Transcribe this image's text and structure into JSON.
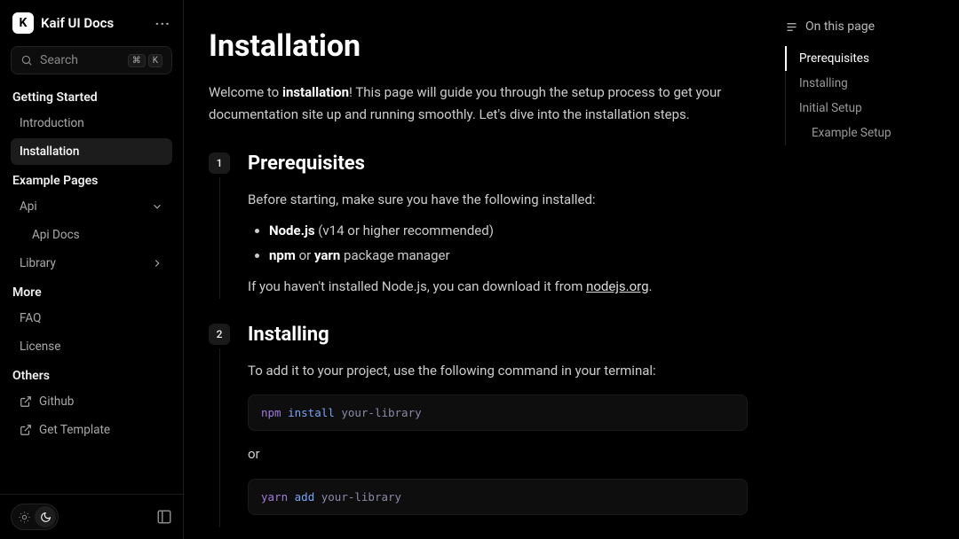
{
  "brand": {
    "logo_letter": "K",
    "title": "Kaif UI Docs"
  },
  "search": {
    "placeholder": "Search",
    "kbd1": "⌘",
    "kbd2": "K"
  },
  "sidebar": {
    "sections": [
      {
        "title": "Getting Started",
        "items": [
          {
            "label": "Introduction",
            "active": false
          },
          {
            "label": "Installation",
            "active": true
          }
        ]
      },
      {
        "title": "Example Pages",
        "items": [
          {
            "label": "Api",
            "chevron": "down",
            "active": false
          },
          {
            "label": "Api Docs",
            "sub": true,
            "active": false
          },
          {
            "label": "Library",
            "chevron": "right",
            "active": false
          }
        ]
      },
      {
        "title": "More",
        "items": [
          {
            "label": "FAQ",
            "active": false
          },
          {
            "label": "License",
            "active": false
          }
        ]
      },
      {
        "title": "Others",
        "items": [
          {
            "label": "Github",
            "icon": "external",
            "active": false
          },
          {
            "label": "Get Template",
            "icon": "external",
            "active": false
          }
        ]
      }
    ]
  },
  "toc": {
    "header": "On this page",
    "items": [
      {
        "label": "Prerequisites",
        "active": true,
        "indent": false
      },
      {
        "label": "Installing",
        "active": false,
        "indent": false
      },
      {
        "label": "Initial Setup",
        "active": false,
        "indent": false
      },
      {
        "label": "Example Setup",
        "active": false,
        "indent": true
      }
    ]
  },
  "content": {
    "title": "Installation",
    "intro_pre": "Welcome to ",
    "intro_bold": "installation",
    "intro_post": "! This page will guide you through the setup process to get your documentation site up and running smoothly. Let's dive into the installation steps.",
    "steps": {
      "prereq": {
        "num": "1",
        "title": "Prerequisites",
        "p1": "Before starting, make sure you have the following installed:",
        "li1_b": "Node.js",
        "li1_t": " (v14 or higher recommended)",
        "li2_b1": "npm",
        "li2_mid": " or ",
        "li2_b2": "yarn",
        "li2_t": " package manager",
        "p2_pre": "If you haven't installed Node.js, you can download it from ",
        "p2_link": "nodejs.org",
        "p2_post": "."
      },
      "install": {
        "num": "2",
        "title": "Installing",
        "p1": "To add it to your project, use the following command in your terminal:",
        "code1_cmd": "npm",
        "code1_arg": "install",
        "code1_pkg": "your-library",
        "or": "or",
        "code2_cmd": "yarn",
        "code2_arg": "add",
        "code2_pkg": "your-library"
      }
    }
  }
}
